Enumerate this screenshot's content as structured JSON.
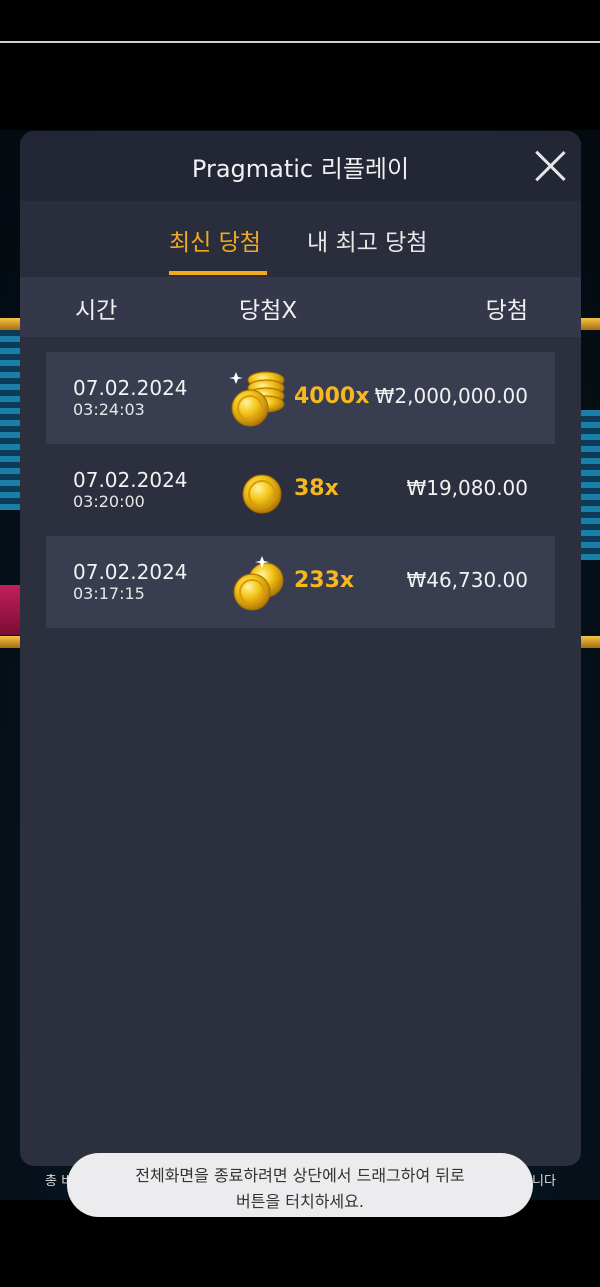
{
  "modal": {
    "title": "Pragmatic 리플레이",
    "tabs": [
      {
        "label": "최신 당첨",
        "active": true
      },
      {
        "label": "내 최고 당첨",
        "active": false
      }
    ],
    "columns": {
      "time": "시간",
      "multiplier": "당첨X",
      "win": "당첨"
    },
    "rows": [
      {
        "date": "07.02.2024",
        "time": "03:24:03",
        "coin_icon": "coin-stack-icon",
        "multiplier": "4000x",
        "amount": "₩2,000,000.00"
      },
      {
        "date": "07.02.2024",
        "time": "03:20:00",
        "coin_icon": "single-coin-icon",
        "multiplier": "38x",
        "amount": "₩19,080.00"
      },
      {
        "date": "07.02.2024",
        "time": "03:17:15",
        "coin_icon": "two-coins-icon",
        "multiplier": "233x",
        "amount": "₩46,730.00"
      }
    ]
  },
  "toast": {
    "line1": "전체화면을 종료하려면 상단에서 드래그하여 뒤로",
    "line2": "버튼을 터치하세요."
  },
  "background": {
    "bottom_left": "총 비",
    "bottom_right": "니다"
  },
  "colors": {
    "accent": "#f2a81f",
    "panel": "#2c2f3e",
    "header": "#232634",
    "row_shade": "#393d50"
  }
}
